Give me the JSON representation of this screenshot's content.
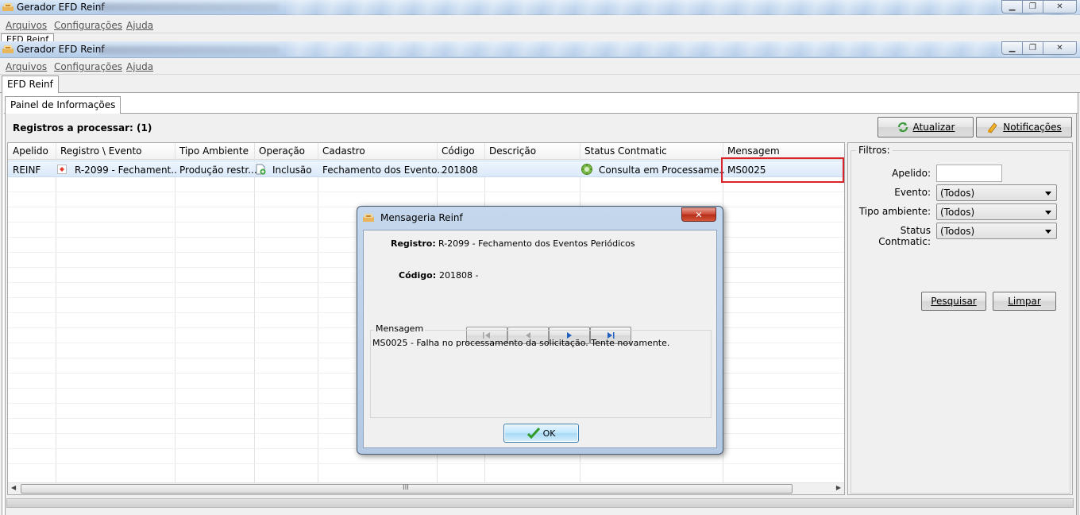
{
  "outer_window": {
    "title": "Gerador EFD Reinf",
    "menu": [
      "Arquivos",
      "Configurações",
      "Ajuda"
    ],
    "tab": "EFD Reinf"
  },
  "window": {
    "title": "Gerador EFD Reinf",
    "menu": [
      "Arquivos",
      "Configurações",
      "Ajuda"
    ],
    "main_tab": "EFD Reinf",
    "sub_tab": "Painel de Informações"
  },
  "grid": {
    "summary": "Registros a processar: (1)",
    "columns": [
      "Apelido",
      "Registro \\ Evento",
      "Tipo Ambiente",
      "Operação",
      "Cadastro",
      "Código",
      "Descrição",
      "Status Contmatic",
      "Mensagem"
    ],
    "rows": [
      {
        "apelido": "REINF",
        "registro": "R-2099 - Fechament...",
        "tipo": "Produção restr...",
        "operacao": "Inclusão",
        "cadastro": "Fechamento dos Evento...",
        "codigo": "201808",
        "descricao": "",
        "status": "Consulta em Processame...",
        "mensagem": "MS0025"
      }
    ]
  },
  "toolbar": {
    "atualizar": "Atualizar",
    "notificacoes": "Notificações"
  },
  "filters": {
    "title": "Filtros:",
    "apelido_label": "Apelido:",
    "apelido_value": "",
    "evento_label": "Evento:",
    "evento_value": "(Todos)",
    "tipo_label": "Tipo ambiente:",
    "tipo_value": "(Todos)",
    "status_label": "Status Contmatic:",
    "status_value": "(Todos)",
    "pesquisar": "Pesquisar",
    "limpar": "Limpar"
  },
  "dialog": {
    "title": "Mensageria Reinf",
    "registro_label": "Registro:",
    "registro_value": "R-2099 - Fechamento dos Eventos Periódicos",
    "codigo_label": "Código:",
    "codigo_value": "201808 -",
    "mensagem_label": "Mensagem",
    "mensagem_text": "MS0025 - Falha no processamento da solicitação. Tente novamente.",
    "ok": "OK"
  },
  "scrollbar_grip": "III",
  "colors": {
    "highlight_box": "#d9242b",
    "selected_row": "#dbe9f9",
    "titlebar": "#c4d8ef"
  }
}
